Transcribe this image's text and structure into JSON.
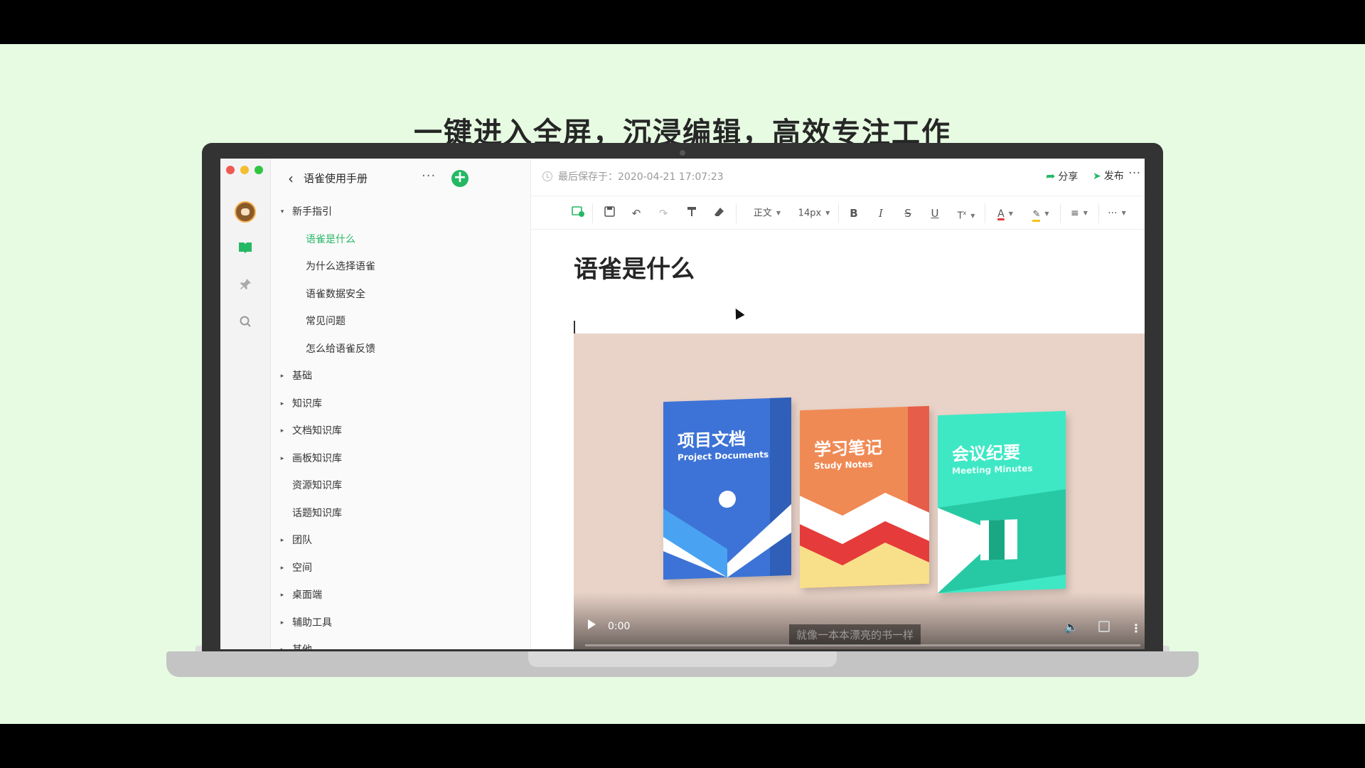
{
  "headline": "一键进入全屏，沉浸编辑，高效专注工作",
  "sidebar": {
    "book_title": "语雀使用手册",
    "more": "···",
    "add": "+",
    "tree": [
      {
        "label": "新手指引",
        "level": 0,
        "caret": "▾",
        "active": false
      },
      {
        "label": "语雀是什么",
        "level": 1,
        "caret": "",
        "active": true
      },
      {
        "label": "为什么选择语雀",
        "level": 1,
        "caret": "",
        "active": false
      },
      {
        "label": "语雀数据安全",
        "level": 1,
        "caret": "",
        "active": false
      },
      {
        "label": "常见问题",
        "level": 1,
        "caret": "",
        "active": false
      },
      {
        "label": "怎么给语雀反馈",
        "level": 1,
        "caret": "",
        "active": false
      },
      {
        "label": "基础",
        "level": 0,
        "caret": "▸",
        "active": false
      },
      {
        "label": "知识库",
        "level": 0,
        "caret": "▸",
        "active": false
      },
      {
        "label": "文档知识库",
        "level": 0,
        "caret": "▸",
        "active": false
      },
      {
        "label": "画板知识库",
        "level": 0,
        "caret": "▸",
        "active": false
      },
      {
        "label": "资源知识库",
        "level": 0,
        "caret": "",
        "active": false
      },
      {
        "label": "话题知识库",
        "level": 0,
        "caret": "",
        "active": false
      },
      {
        "label": "团队",
        "level": 0,
        "caret": "▸",
        "active": false
      },
      {
        "label": "空间",
        "level": 0,
        "caret": "▸",
        "active": false
      },
      {
        "label": "桌面端",
        "level": 0,
        "caret": "▸",
        "active": false
      },
      {
        "label": "辅助工具",
        "level": 0,
        "caret": "▸",
        "active": false
      },
      {
        "label": "其他",
        "level": 0,
        "caret": "▸",
        "active": false
      }
    ]
  },
  "editor": {
    "saved": "最后保存于：2020-04-21 17:07:23",
    "share": "分享",
    "publish": "发布",
    "more": "···",
    "toolbar": {
      "style": "正文",
      "size": "14px",
      "bold": "B",
      "italic": "I",
      "strike": "S",
      "underline": "U",
      "more": "···"
    },
    "doc_title": "语雀是什么"
  },
  "video": {
    "time": "0:00",
    "caption": "就像一本本漂亮的书一样",
    "books": [
      {
        "title": "项目文档",
        "subtitle": "Project Documents"
      },
      {
        "title": "学习笔记",
        "subtitle": "Study Notes"
      },
      {
        "title": "会议纪要",
        "subtitle": "Meeting Minutes"
      }
    ]
  },
  "colors": {
    "background": "#e6fbe2",
    "accent": "#25b864",
    "laptop": "#333333"
  }
}
